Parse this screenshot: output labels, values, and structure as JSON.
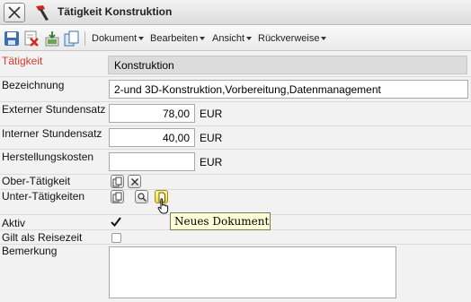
{
  "window": {
    "title": "Tätigkeit Konstruktion"
  },
  "toolbar": {
    "icons": [
      "save-icon",
      "delete-icon",
      "export-icon",
      "copy-icon"
    ],
    "menus": [
      "Dokument",
      "Bearbeiten",
      "Ansicht",
      "Rückverweise"
    ]
  },
  "form": {
    "taetigkeit": {
      "label": "Tätigkeit",
      "value": "Konstruktion",
      "label_color": "#d63a2a"
    },
    "bezeichnung": {
      "label": "Bezeichnung",
      "value": "2-und 3D-Konstruktion,Vorbereitung,Datenmanagement"
    },
    "externer_stundensatz": {
      "label": "Externer Stundensatz",
      "value": "78,00",
      "unit": "EUR"
    },
    "interner_stundensatz": {
      "label": "Interner Stundensatz",
      "value": "40,00",
      "unit": "EUR"
    },
    "herstellungskosten": {
      "label": "Herstellungskosten",
      "value": "",
      "unit": "EUR"
    },
    "ober_taetigkeit": {
      "label": "Ober-Tätigkeit"
    },
    "unter_taetigkeiten": {
      "label": "Unter-Tätigkeiten"
    },
    "aktiv": {
      "label": "Aktiv",
      "checked": true
    },
    "reisezeit": {
      "label": "Gilt als Reisezeit",
      "checked": false
    },
    "bemerkung": {
      "label": "Bemerkung",
      "value": ""
    }
  },
  "tooltip": {
    "text": "Neues Dokument"
  }
}
